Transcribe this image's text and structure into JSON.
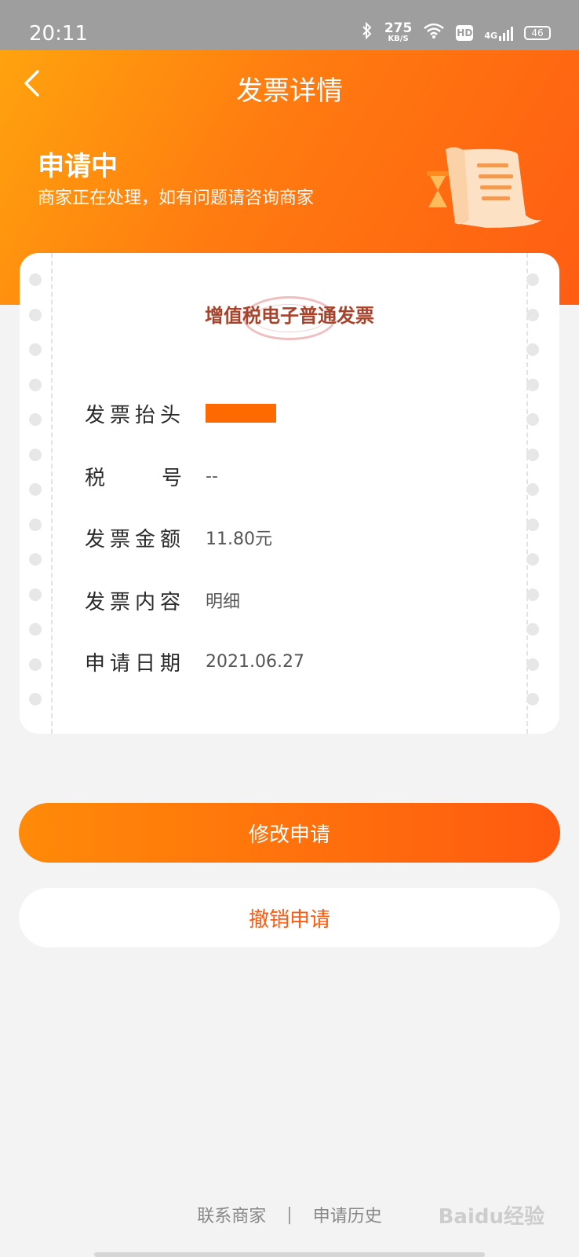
{
  "status_bar": {
    "time": "20:11",
    "net_speed": "275",
    "net_unit": "KB/S",
    "hd": "HD",
    "network": "4G",
    "battery": "46"
  },
  "nav": {
    "title": "发票详情",
    "back_icon": "chevron-left-icon"
  },
  "application_status": {
    "title": "申请中",
    "description": "商家正在处理，如有问题请咨询商家",
    "illustration": "scroll-hourglass-icon"
  },
  "invoice": {
    "type": "增值税电子普通发票",
    "fields": [
      {
        "label": "发票抬头",
        "value": ""
      },
      {
        "label_chars": [
          "税",
          "号"
        ],
        "value": "--"
      },
      {
        "label": "发票金额",
        "value": "11.80元"
      },
      {
        "label": "发票内容",
        "value": "明细"
      },
      {
        "label": "申请日期",
        "value": "2021.06.27"
      }
    ]
  },
  "actions": {
    "modify": "修改申请",
    "cancel": "撤销申请"
  },
  "footer": {
    "contact": "联系商家",
    "separator": "|",
    "history": "申请历史"
  },
  "watermark": "Baidu经验",
  "colors": {
    "brand_orange": "#ff6a10",
    "invoice_type_text": "#a7432b"
  }
}
